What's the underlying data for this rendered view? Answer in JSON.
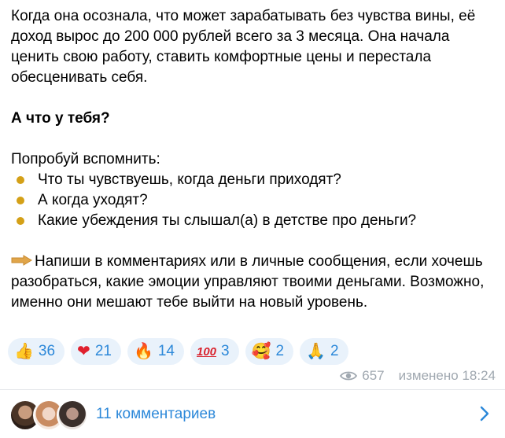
{
  "post": {
    "paragraph1": "Когда она осознала, что может зарабатывать без чувства вины, её доход вырос до 200 000 рублей всего за 3 месяца. Она начала ценить свою работу, ставить комфортные цены и перестала обесценивать себя.",
    "question": "А что у тебя?",
    "prompt": "Попробуй вспомнить:",
    "bullets": [
      "Что ты чувствуешь, когда деньги приходят?",
      "А когда уходят?",
      "Какие убеждения ты слышал(а) в детстве про деньги?"
    ],
    "cta": "Напиши в комментариях или в личные сообщения, если хочешь разобраться, какие эмоции управляют твоими деньгами. Возможно, именно они мешают тебе выйти на новый уровень."
  },
  "reactions": [
    {
      "emoji": "👍",
      "count": "36"
    },
    {
      "emoji": "❤",
      "count": "21"
    },
    {
      "emoji": "🔥",
      "count": "14"
    },
    {
      "emoji": "100",
      "count": "3"
    },
    {
      "emoji": "🥰",
      "count": "2"
    },
    {
      "emoji": "🙏",
      "count": "2"
    }
  ],
  "meta": {
    "views": "657",
    "edited": "изменено 18:24"
  },
  "comments": {
    "label": "11 комментариев"
  },
  "colors": {
    "accent": "#2c88d9",
    "reaction_bg": "#e9f2fb",
    "bullet": "#d4a017",
    "meta": "#a0a8b0"
  }
}
